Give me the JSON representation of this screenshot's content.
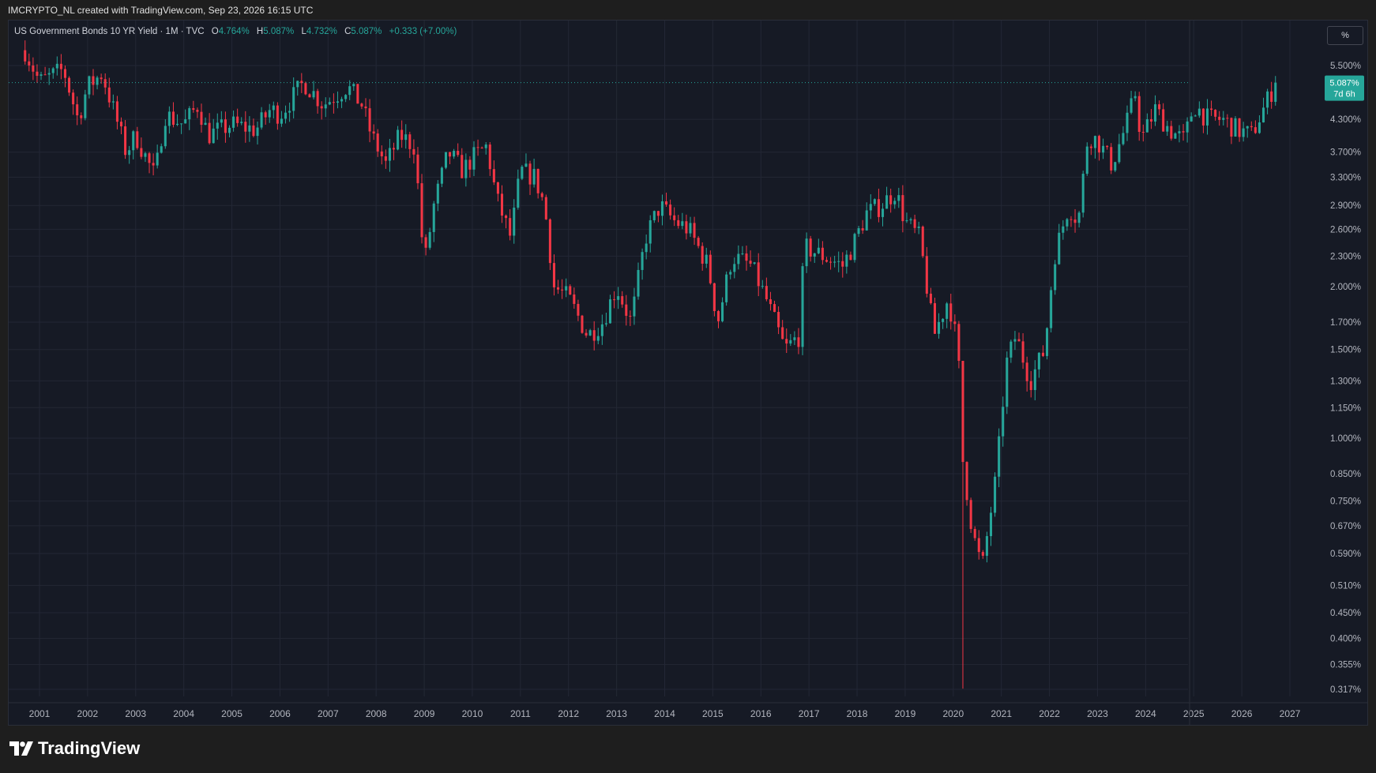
{
  "caption": "IMCRYPTO_NL created with TradingView.com, Sep 23, 2026 16:15 UTC",
  "legend": {
    "symbol": "US Government Bonds 10 YR Yield · 1M · TVC",
    "open_label": "O",
    "open": "4.764%",
    "high_label": "H",
    "high": "5.087%",
    "low_label": "L",
    "low": "4.732%",
    "close_label": "C",
    "close": "5.087%",
    "change": "+0.333 (+7.00%)"
  },
  "scale_button": "%",
  "price_tag": {
    "value": "5.087%",
    "countdown": "7d 6h"
  },
  "brand": "TradingView",
  "colors": {
    "up": "#26a69a",
    "down": "#f23645",
    "grid": "#232735",
    "axis_text": "#b2b5be",
    "background": "#161a25"
  },
  "chart_data": {
    "type": "candlestick",
    "log_scale": true,
    "y_ticks": [
      "5.500%",
      "4.300%",
      "3.700%",
      "3.300%",
      "2.900%",
      "2.600%",
      "2.300%",
      "2.000%",
      "1.700%",
      "1.500%",
      "1.300%",
      "1.150%",
      "1.000%",
      "0.850%",
      "0.750%",
      "0.670%",
      "0.590%",
      "0.510%",
      "0.450%",
      "0.400%",
      "0.355%",
      "0.317%"
    ],
    "y_tick_values": [
      5.5,
      4.3,
      3.7,
      3.3,
      2.9,
      2.6,
      2.3,
      2.0,
      1.7,
      1.5,
      1.3,
      1.15,
      1.0,
      0.85,
      0.75,
      0.67,
      0.59,
      0.51,
      0.45,
      0.4,
      0.355,
      0.317
    ],
    "x_ticks": [
      "2001",
      "2002",
      "2003",
      "2004",
      "2005",
      "2006",
      "2007",
      "2008",
      "2009",
      "2010",
      "2011",
      "2012",
      "2013",
      "2014",
      "2015",
      "2016",
      "2017",
      "2018",
      "2019",
      "2020",
      "2021",
      "2022",
      "2023",
      "2024",
      "2025",
      "2026",
      "2027"
    ],
    "x_tick_years": [
      2001,
      2002,
      2003,
      2004,
      2005,
      2006,
      2007,
      2008,
      2009,
      2010,
      2011,
      2012,
      2013,
      2014,
      2015,
      2016,
      2017,
      2018,
      2019,
      2020,
      2021,
      2022,
      2023,
      2024,
      2025,
      2026,
      2027
    ],
    "start": "2000-09",
    "end": "2026-09",
    "ylim": [
      0.3,
      6.2
    ],
    "last_close": 5.087,
    "monthly_close_approx": [
      [
        2000.7,
        5.9
      ],
      [
        2001.0,
        5.1
      ],
      [
        2001.5,
        5.4
      ],
      [
        2001.8,
        4.3
      ],
      [
        2002.0,
        5.0
      ],
      [
        2002.3,
        5.3
      ],
      [
        2002.6,
        4.3
      ],
      [
        2002.8,
        3.7
      ],
      [
        2003.0,
        4.0
      ],
      [
        2003.4,
        3.3
      ],
      [
        2003.6,
        4.4
      ],
      [
        2004.0,
        4.2
      ],
      [
        2004.3,
        4.6
      ],
      [
        2004.5,
        4.0
      ],
      [
        2005.0,
        4.2
      ],
      [
        2005.5,
        4.1
      ],
      [
        2005.8,
        4.5
      ],
      [
        2006.0,
        4.4
      ],
      [
        2006.5,
        5.1
      ],
      [
        2006.9,
        4.6
      ],
      [
        2007.4,
        5.0
      ],
      [
        2007.7,
        4.6
      ],
      [
        2007.9,
        4.0
      ],
      [
        2008.2,
        3.5
      ],
      [
        2008.5,
        4.0
      ],
      [
        2008.8,
        3.8
      ],
      [
        2009.0,
        2.2
      ],
      [
        2009.2,
        2.9
      ],
      [
        2009.5,
        3.7
      ],
      [
        2009.8,
        3.4
      ],
      [
        2010.0,
        3.6
      ],
      [
        2010.3,
        3.8
      ],
      [
        2010.5,
        3.0
      ],
      [
        2010.8,
        2.5
      ],
      [
        2011.0,
        3.4
      ],
      [
        2011.3,
        3.3
      ],
      [
        2011.5,
        2.9
      ],
      [
        2011.7,
        2.0
      ],
      [
        2012.0,
        1.9
      ],
      [
        2012.4,
        1.6
      ],
      [
        2012.7,
        1.7
      ],
      [
        2013.0,
        2.0
      ],
      [
        2013.3,
        1.7
      ],
      [
        2013.6,
        2.5
      ],
      [
        2013.9,
        2.9
      ],
      [
        2014.2,
        2.7
      ],
      [
        2014.5,
        2.6
      ],
      [
        2014.9,
        2.2
      ],
      [
        2015.1,
        1.7
      ],
      [
        2015.4,
        2.3
      ],
      [
        2015.8,
        2.2
      ],
      [
        2016.1,
        1.9
      ],
      [
        2016.5,
        1.5
      ],
      [
        2016.8,
        1.6
      ],
      [
        2016.9,
        2.4
      ],
      [
        2017.3,
        2.3
      ],
      [
        2017.7,
        2.2
      ],
      [
        2017.9,
        2.4
      ],
      [
        2018.2,
        2.8
      ],
      [
        2018.5,
        2.9
      ],
      [
        2018.8,
        3.1
      ],
      [
        2019.0,
        2.7
      ],
      [
        2019.3,
        2.5
      ],
      [
        2019.6,
        1.6
      ],
      [
        2019.9,
        1.9
      ],
      [
        2020.1,
        1.5
      ],
      [
        2020.2,
        0.9
      ],
      [
        2020.4,
        0.65
      ],
      [
        2020.6,
        0.55
      ],
      [
        2020.9,
        0.85
      ],
      [
        2021.1,
        1.4
      ],
      [
        2021.3,
        1.6
      ],
      [
        2021.6,
        1.3
      ],
      [
        2021.9,
        1.5
      ],
      [
        2022.1,
        2.3
      ],
      [
        2022.4,
        2.9
      ],
      [
        2022.6,
        2.7
      ],
      [
        2022.8,
        4.0
      ],
      [
        2023.0,
        3.9
      ],
      [
        2023.3,
        3.5
      ],
      [
        2023.6,
        4.2
      ],
      [
        2023.8,
        4.9
      ],
      [
        2023.9,
        3.9
      ],
      [
        2024.2,
        4.5
      ],
      [
        2024.5,
        4.1
      ],
      [
        2024.8,
        3.9
      ],
      [
        2025.0,
        4.6
      ],
      [
        2025.3,
        4.3
      ],
      [
        2025.6,
        4.3
      ],
      [
        2025.9,
        4.1
      ],
      [
        2026.2,
        4.0
      ],
      [
        2026.4,
        4.4
      ],
      [
        2026.7,
        5.087
      ]
    ]
  }
}
